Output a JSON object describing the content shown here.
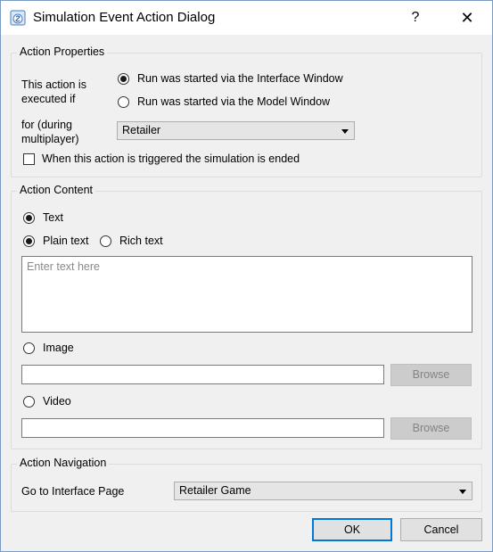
{
  "window": {
    "title": "Simulation Event Action Dialog",
    "help_label": "?",
    "close_label": "✕"
  },
  "action_properties": {
    "title": "Action Properties",
    "executed_label_line1": "This action is",
    "executed_label_line2": "executed if",
    "radio_interface": "Run was started via the Interface Window",
    "radio_model": "Run was started via the Model Window",
    "for_label_line1": "for (during",
    "for_label_line2": "multiplayer)",
    "player_selected": "Retailer",
    "end_simulation_label": "When this action is triggered the simulation is ended"
  },
  "action_content": {
    "title": "Action Content",
    "text_radio": "Text",
    "plain_text_radio": "Plain text",
    "rich_text_radio": "Rich text",
    "text_placeholder": "Enter text here",
    "image_radio": "Image",
    "image_browse": "Browse",
    "video_radio": "Video",
    "video_browse": "Browse"
  },
  "action_navigation": {
    "title": "Action Navigation",
    "goto_label": "Go to Interface Page",
    "page_selected": "Retailer Game"
  },
  "buttons": {
    "ok": "OK",
    "cancel": "Cancel"
  }
}
